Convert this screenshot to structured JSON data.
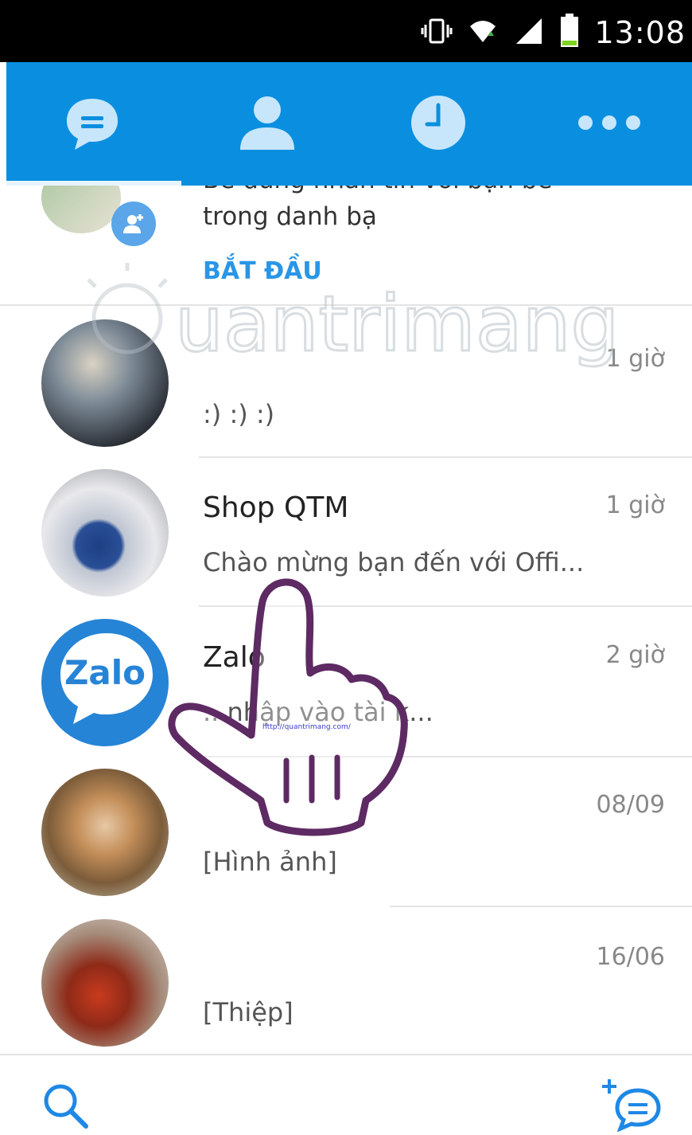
{
  "status_bar": {
    "time": "13:08",
    "icons": [
      "vibrate-icon",
      "wifi-icon",
      "signal-icon",
      "battery-icon"
    ]
  },
  "tabs": [
    {
      "name": "messages",
      "icon": "chat-bubble-icon",
      "active": true
    },
    {
      "name": "contacts",
      "icon": "person-icon",
      "active": false
    },
    {
      "name": "timeline",
      "icon": "clock-icon",
      "active": false
    },
    {
      "name": "more",
      "icon": "more-dots-icon",
      "active": false
    }
  ],
  "banner": {
    "text": "Bè dùng nhắn tin với bạn bè trong danh bạ",
    "action": "BẮT ĐẦU"
  },
  "conversations": [
    {
      "name": "",
      "time": "1 giờ",
      "preview": ":) :) :)"
    },
    {
      "name": "Shop QTM",
      "time": "1 giờ",
      "preview": "Chào mừng bạn đến với Offi..."
    },
    {
      "name": "Zalo",
      "time": "2 giờ",
      "preview": "...nhập vào tài k..."
    },
    {
      "name": "",
      "time": "08/09",
      "preview": "[Hình ảnh]"
    },
    {
      "name": "",
      "time": "16/06",
      "preview": "[Thiệp]"
    }
  ],
  "avatars": {
    "zalo_logo_text": "Zalo"
  },
  "watermark": {
    "text": "uantrimang",
    "hand_text": "http://quantrimang.com/"
  },
  "colors": {
    "accent": "#0a8fe0",
    "link": "#2a96e6",
    "icon_light": "#c8e6fb"
  }
}
